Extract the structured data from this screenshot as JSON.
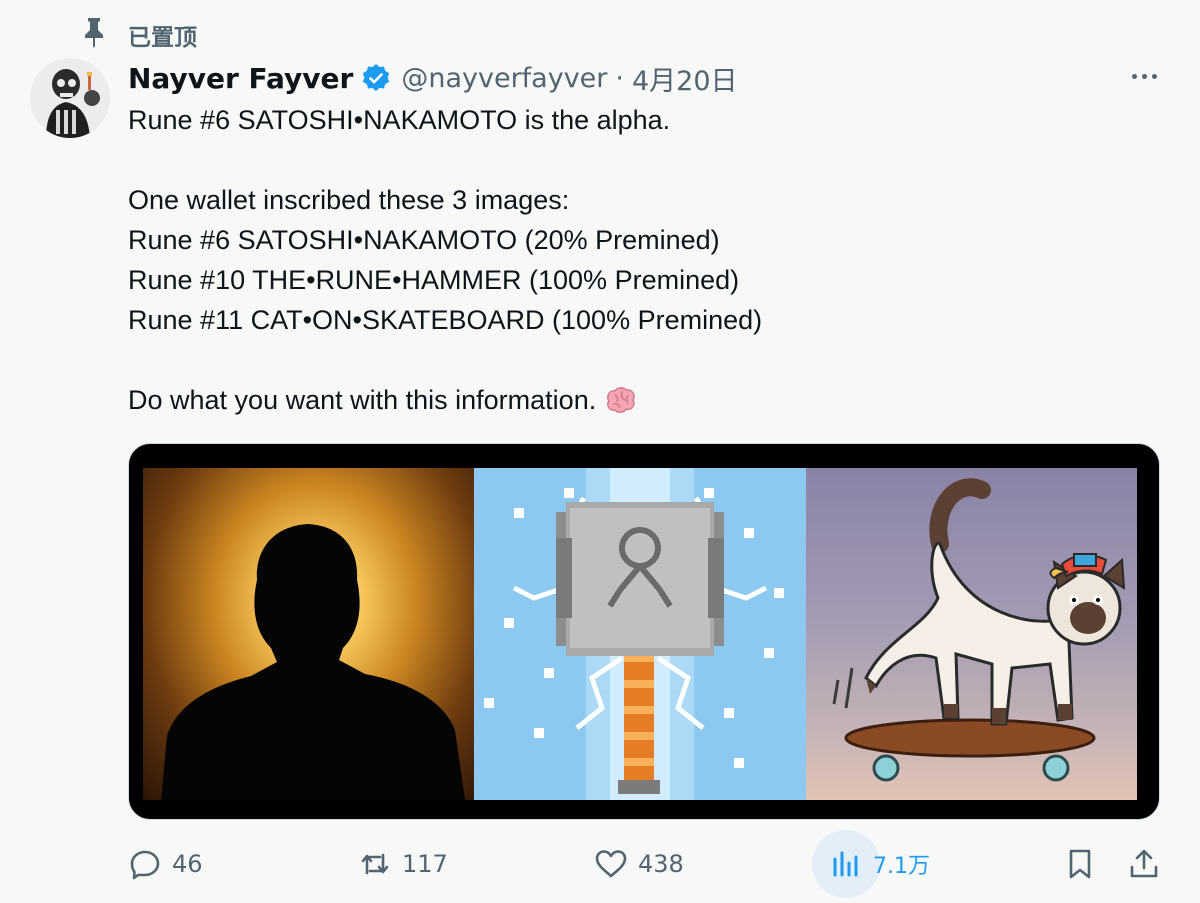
{
  "pinned": {
    "label": "已置顶"
  },
  "tweet": {
    "author_name": "Nayver Fayver",
    "handle": "@nayverfayver",
    "separator": "·",
    "date": "4月20日",
    "lines": [
      "Rune #6 SATOSHI•NAKAMOTO is the alpha.",
      "",
      "One wallet inscribed these 3 images:",
      "Rune #6 SATOSHI•NAKAMOTO (20% Premined)",
      "Rune #10 THE•RUNE•HAMMER (100% Premined)",
      "Rune #11 CAT•ON•SKATEBOARD (100% Premined)",
      "",
      "Do what you want with this information."
    ],
    "trailing_emoji": "brain-emoji-icon"
  },
  "actions": {
    "replies": "46",
    "reposts": "117",
    "likes": "438",
    "views": "7.1万"
  },
  "colors": {
    "text_primary": "#0f1419",
    "text_secondary": "#536471",
    "accent": "#1d9bf0",
    "background": "#f7f9f9"
  }
}
